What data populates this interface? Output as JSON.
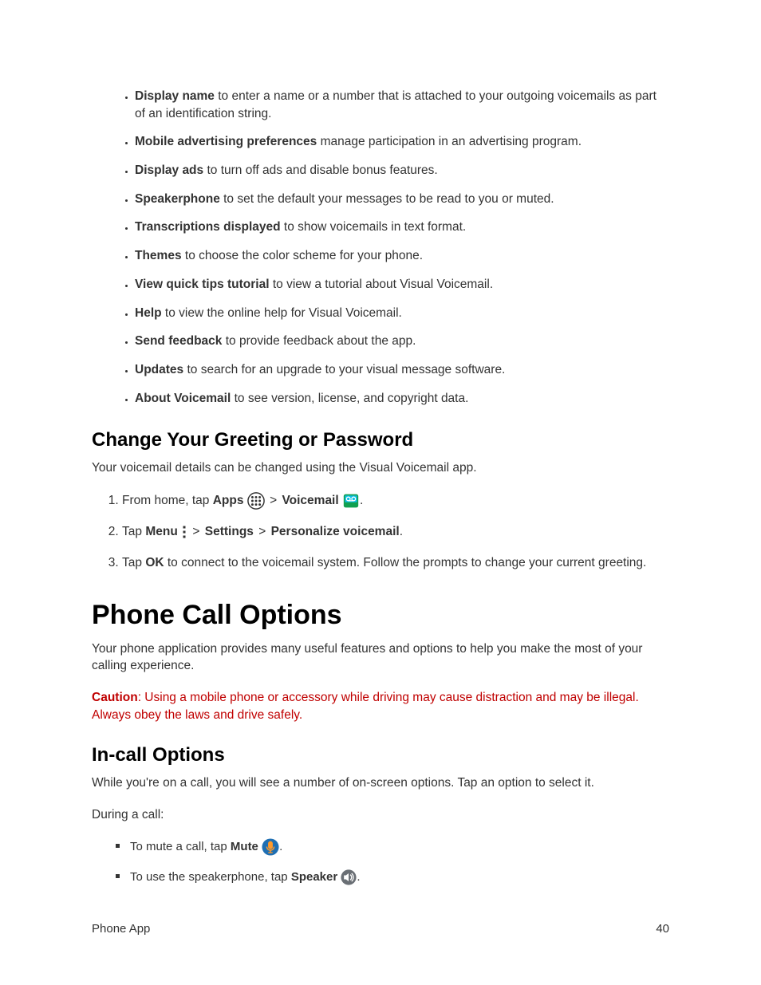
{
  "settings_list": [
    {
      "label": "Display name",
      "desc": " to enter a name or a number that is attached to your outgoing voicemails as part of an identification string."
    },
    {
      "label": "Mobile advertising preferences",
      "desc": " manage participation in an advertising program."
    },
    {
      "label": "Display ads",
      "desc": " to turn off ads and disable bonus features."
    },
    {
      "label": "Speakerphone",
      "desc": " to set the default your messages to be read to you or muted."
    },
    {
      "label": "Transcriptions displayed",
      "desc": " to show voicemails in text format."
    },
    {
      "label": "Themes",
      "desc": " to choose the color scheme for your phone."
    },
    {
      "label": "View quick tips tutorial",
      "desc": " to view a tutorial about Visual Voicemail."
    },
    {
      "label": "Help",
      "desc": " to view the online help for Visual Voicemail."
    },
    {
      "label": "Send feedback",
      "desc": " to provide feedback about the app."
    },
    {
      "label": "Updates",
      "desc": " to search for an upgrade to your visual message software."
    },
    {
      "label": "About Voicemail",
      "desc": " to see version, license, and copyright data."
    }
  ],
  "h2_greeting": "Change Your Greeting or Password",
  "greeting_intro": "Your voicemail details can be changed using the Visual Voicemail app.",
  "steps": {
    "s1_pre": "From home, tap ",
    "s1_apps": "Apps",
    "s1_gt": " > ",
    "s1_voicemail": "Voicemail",
    "s1_post": ".",
    "s2_pre": "Tap ",
    "s2_menu": "Menu",
    "s2_gt1": " > ",
    "s2_settings": "Settings",
    "s2_gt2": " > ",
    "s2_personalize": "Personalize voicemail",
    "s2_post": ".",
    "s3_pre": "Tap ",
    "s3_ok": "OK",
    "s3_post": " to connect to the voicemail system. Follow the prompts to change your current greeting."
  },
  "h1_phone_call": "Phone Call Options",
  "phone_call_intro": "Your phone application provides many useful features and options to help you make the most of your calling experience.",
  "caution_label": "Caution",
  "caution_text": ": Using a mobile phone or accessory while driving may cause distraction and may be illegal. Always obey the laws and drive safely.",
  "h2_incall": "In-call Options",
  "incall_intro": "While you're on a call, you will see a number of on-screen options. Tap an option to select it.",
  "during_call": "During a call:",
  "incall_items": {
    "mute_pre": "To mute a call, tap ",
    "mute_label": "Mute",
    "mute_post": ".",
    "speaker_pre": "To use the speakerphone, tap ",
    "speaker_label": "Speaker",
    "speaker_post": "."
  },
  "footer_left": "Phone App",
  "footer_right": "40"
}
